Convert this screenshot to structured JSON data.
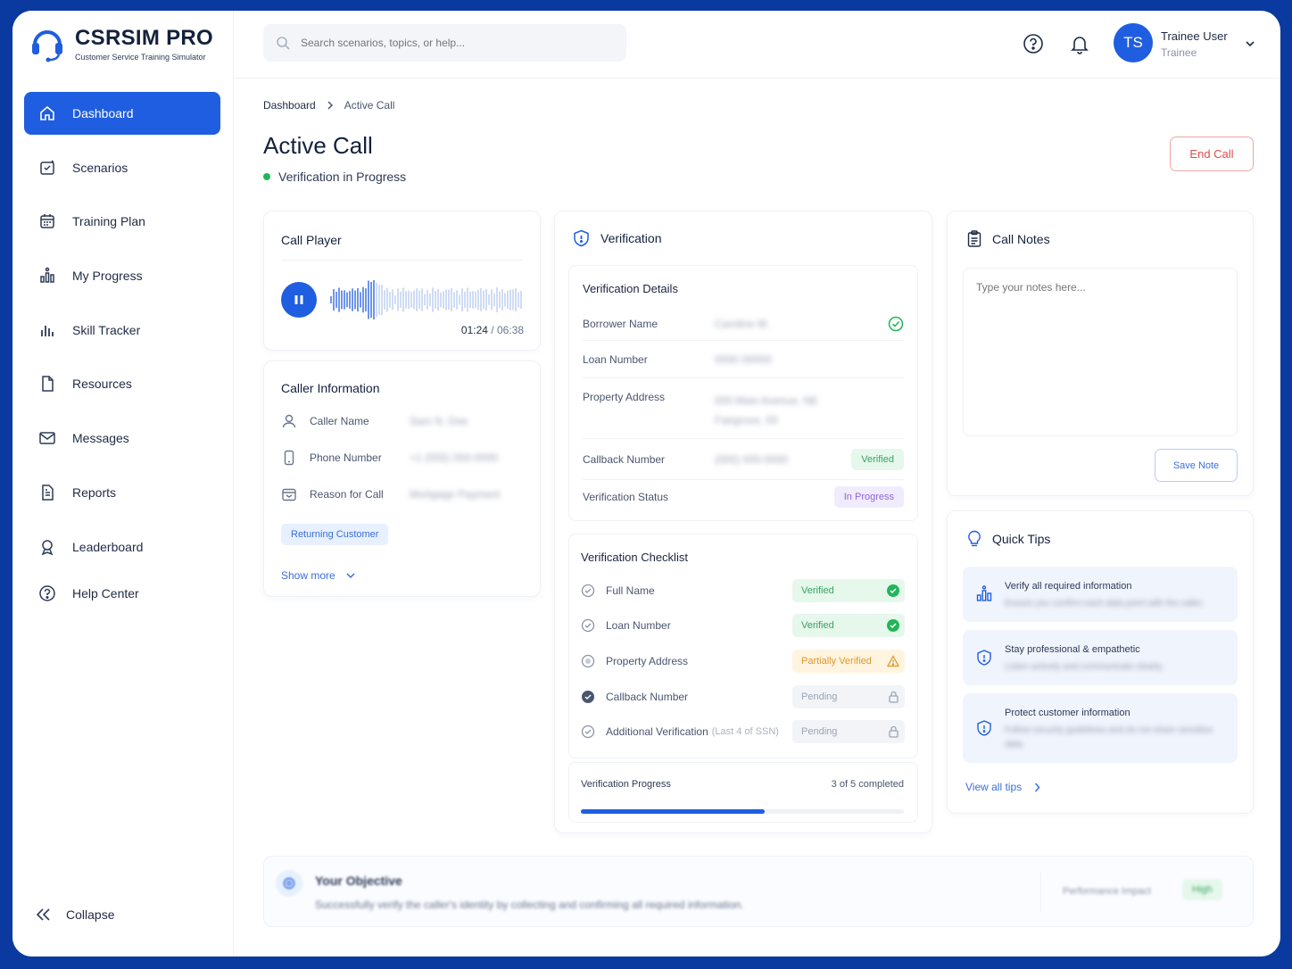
{
  "brand": {
    "title": "CSRSIM PRO",
    "subtitle": "Customer Service Training Simulator"
  },
  "sidebar": {
    "items": [
      {
        "label": "Dashboard",
        "icon": "home-icon"
      },
      {
        "label": "Scenarios",
        "icon": "scenarios-icon"
      },
      {
        "label": "Training Plan",
        "icon": "calendar-icon"
      },
      {
        "label": "My Progress",
        "icon": "progress-icon"
      },
      {
        "label": "Skill Tracker",
        "icon": "bar-chart-icon"
      },
      {
        "label": "Resources",
        "icon": "document-icon"
      },
      {
        "label": "Messages",
        "icon": "mail-icon"
      },
      {
        "label": "Reports",
        "icon": "report-icon"
      },
      {
        "label": "Leaderboard",
        "icon": "trophy-icon"
      },
      {
        "label": "Help Center",
        "icon": "help-icon"
      }
    ],
    "collapse_label": "Collapse"
  },
  "header": {
    "search_placeholder": "Search scenarios, topics, or help...",
    "user": {
      "initials": "TS",
      "name": "Trainee User",
      "role": "Trainee"
    }
  },
  "breadcrumb": {
    "root": "Dashboard",
    "current": "Active Call"
  },
  "page": {
    "title": "Active Call",
    "status": "Verification in Progress",
    "end_call_label": "End Call"
  },
  "call_player": {
    "title": "Call Player",
    "current_time": "01:24",
    "total_time": "/ 06:38",
    "progress": 0.22
  },
  "caller_info": {
    "title": "Caller Information",
    "rows": [
      {
        "label": "Caller Name",
        "value": "Sam N. Doe"
      },
      {
        "label": "Phone Number",
        "value": "+1 (555) 000-0000"
      },
      {
        "label": "Reason for Call",
        "value": "Mortgage Payment"
      }
    ],
    "tag": "Returning Customer",
    "show_more": "Show more"
  },
  "verification": {
    "title": "Verification",
    "details_title": "Verification Details",
    "details": {
      "borrower_label": "Borrower Name",
      "borrower_value": "Caroline M.",
      "loan_label": "Loan Number",
      "loan_value": "0000 00000",
      "address_label": "Property Address",
      "address_line1": "000 Main Avenue, NE",
      "address_line2": "Fairgrove, 00",
      "callback_label": "Callback Number",
      "callback_value": "(000) 000-0000",
      "callback_badge": "Verified",
      "status_label": "Verification Status",
      "status_badge": "In Progress"
    },
    "checklist_title": "Verification Checklist",
    "checklist": [
      {
        "label": "Full Name",
        "suffix": "",
        "status": "Verified"
      },
      {
        "label": "Loan Number",
        "suffix": "",
        "status": "Verified"
      },
      {
        "label": "Property Address",
        "suffix": "",
        "status": "Partially Verified"
      },
      {
        "label": "Callback Number",
        "suffix": "",
        "status": "Pending"
      },
      {
        "label": "Additional Verification",
        "suffix": "(Last 4 of SSN)",
        "status": "Pending"
      }
    ],
    "progress_label": "Verification Progress",
    "progress_text": "3 of 5 completed",
    "progress_value": 0.57
  },
  "notes": {
    "title": "Call Notes",
    "placeholder": "Type your notes here...",
    "save_label": "Save Note"
  },
  "tips": {
    "title": "Quick Tips",
    "items": [
      {
        "title": "Verify all required information",
        "desc": "Ensure you confirm each data point with the caller."
      },
      {
        "title": "Stay professional & empathetic",
        "desc": "Listen actively and communicate clearly."
      },
      {
        "title": "Protect customer information",
        "desc": "Follow security guidelines and do not share sensitive data."
      }
    ],
    "view_all": "View all tips"
  },
  "objective": {
    "title": "Your Objective",
    "desc": "Successfully verify the caller's identity by collecting and confirming all required information.",
    "impact_label": "Performance Impact",
    "impact_value": "High"
  },
  "colors": {
    "primary": "#1f5ee0",
    "success": "#22b55a",
    "danger": "#e24a4a",
    "warning": "#e0982a"
  }
}
